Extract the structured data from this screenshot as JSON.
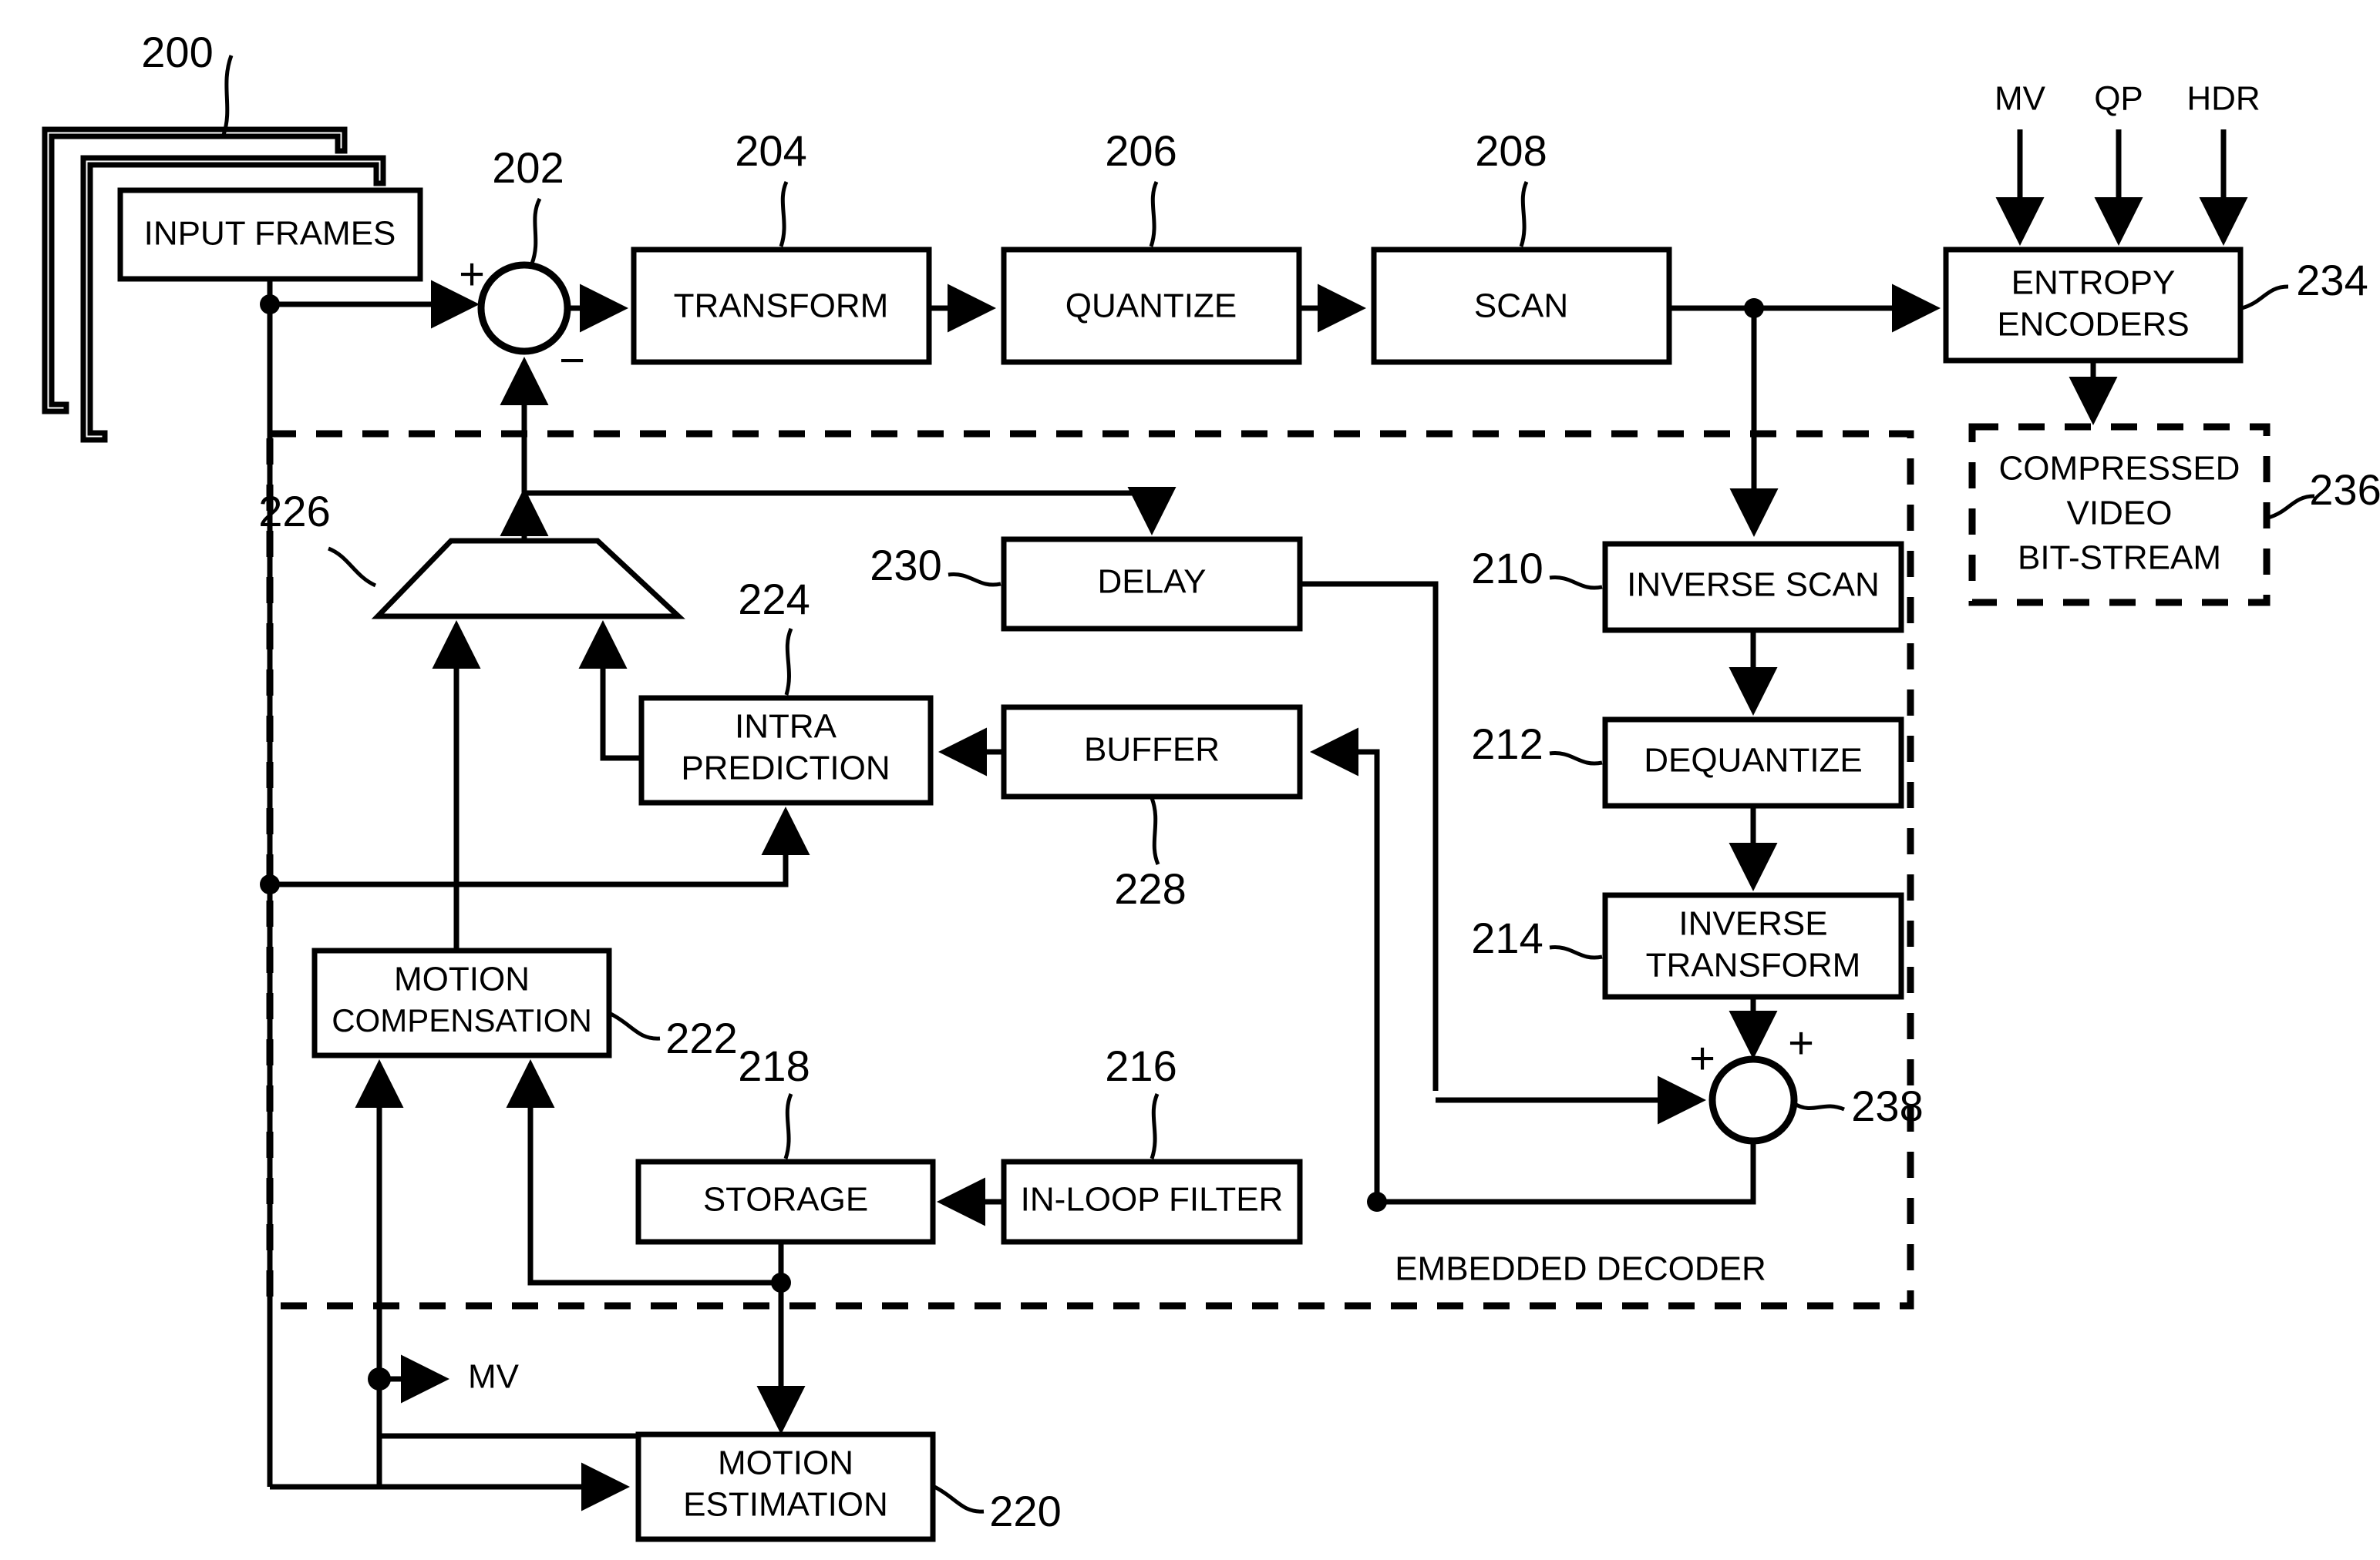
{
  "figure": {
    "type": "patent-block-diagram",
    "title_text": "",
    "region_label": "EMBEDDED DECODER"
  },
  "blocks": {
    "input_frames": {
      "label": "INPUT FRAMES",
      "ref": "200"
    },
    "transform": {
      "label": "TRANSFORM",
      "ref": "204"
    },
    "quantize": {
      "label": "QUANTIZE",
      "ref": "206"
    },
    "scan": {
      "label": "SCAN",
      "ref": "208"
    },
    "entropy_encoders": {
      "label_line1": "ENTROPY",
      "label_line2": "ENCODERS",
      "ref": "234"
    },
    "compressed_bitstream": {
      "label_line1": "COMPRESSED",
      "label_line2": "VIDEO",
      "label_line3": "BIT-STREAM",
      "ref": "236"
    },
    "inverse_scan": {
      "label": "INVERSE SCAN",
      "ref": "210"
    },
    "dequantize": {
      "label": "DEQUANTIZE",
      "ref": "212"
    },
    "inverse_transform": {
      "label_line1": "INVERSE",
      "label_line2": "TRANSFORM",
      "ref": "214"
    },
    "delay": {
      "label": "DELAY",
      "ref": "230"
    },
    "buffer": {
      "label": "BUFFER",
      "ref": "228"
    },
    "intra_prediction": {
      "label_line1": "INTRA",
      "label_line2": "PREDICTION",
      "ref": "224"
    },
    "mux": {
      "label": "",
      "ref": "226"
    },
    "motion_compensation": {
      "label_line1": "MOTION",
      "label_line2": "COMPENSATION",
      "ref": "222"
    },
    "storage": {
      "label": "STORAGE",
      "ref": "218"
    },
    "in_loop_filter": {
      "label": "IN-LOOP FILTER",
      "ref": "216"
    },
    "motion_estimation": {
      "label_line1": "MOTION",
      "label_line2": "ESTIMATION",
      "ref": "220"
    },
    "subtractor": {
      "ref": "202",
      "sign_plus": "+",
      "sign_minus": "−"
    },
    "adder": {
      "ref": "238",
      "sign_plus_left": "+",
      "sign_plus_top": "+"
    }
  },
  "signals": {
    "mv_top": "MV",
    "qp_top": "QP",
    "hdr_top": "HDR",
    "mv_out": "MV"
  },
  "colors": {
    "line": "#000000",
    "fill": "#ffffff",
    "text": "#000000"
  }
}
